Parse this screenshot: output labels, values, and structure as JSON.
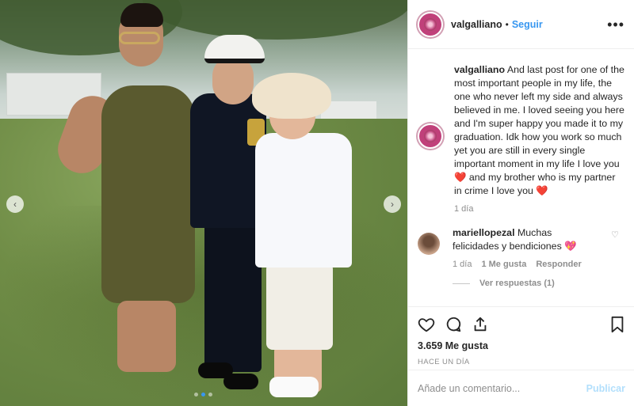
{
  "post": {
    "username": "valgalliano",
    "separator": "•",
    "follow_label": "Seguir",
    "more_label": "•••",
    "caption_username": "valgalliano",
    "caption_part1": "And last post for one of the most important people in my life, the one who never left my side and always believed in me. I loved seeing you here and I'm super happy you made it to my graduation. Idk how you work so much yet you are still in every single important moment in my life I love you",
    "caption_heart1": "❤️",
    "caption_part2": "and my brother who is my partner in crime I love you",
    "caption_heart2": "❤️",
    "caption_time": "1 día"
  },
  "comment": {
    "username": "mariellopezal",
    "text": "Muchas felicidades y bendiciones",
    "emoji": "💖",
    "like_icon": "♡",
    "time": "1 día",
    "likes": "1 Me gusta",
    "reply_label": "Responder",
    "view_replies": "Ver respuestas (1)"
  },
  "actions": {
    "icons": [
      "heart-outline-icon",
      "comment-icon",
      "share-icon",
      "bookmark-icon"
    ],
    "likes_count": "3.659 Me gusta",
    "posted_ago": "HACE UN DÍA"
  },
  "add_comment": {
    "placeholder": "Añade un comentario...",
    "post_label": "Publicar"
  },
  "carousel": {
    "prev_icon": "‹",
    "next_icon": "›",
    "slides": 3,
    "active_slide": 2
  },
  "colors": {
    "accent": "#3897f0",
    "heart": "#e02440",
    "muted": "#8e8e8e",
    "publish_disabled": "#b2dffc"
  }
}
